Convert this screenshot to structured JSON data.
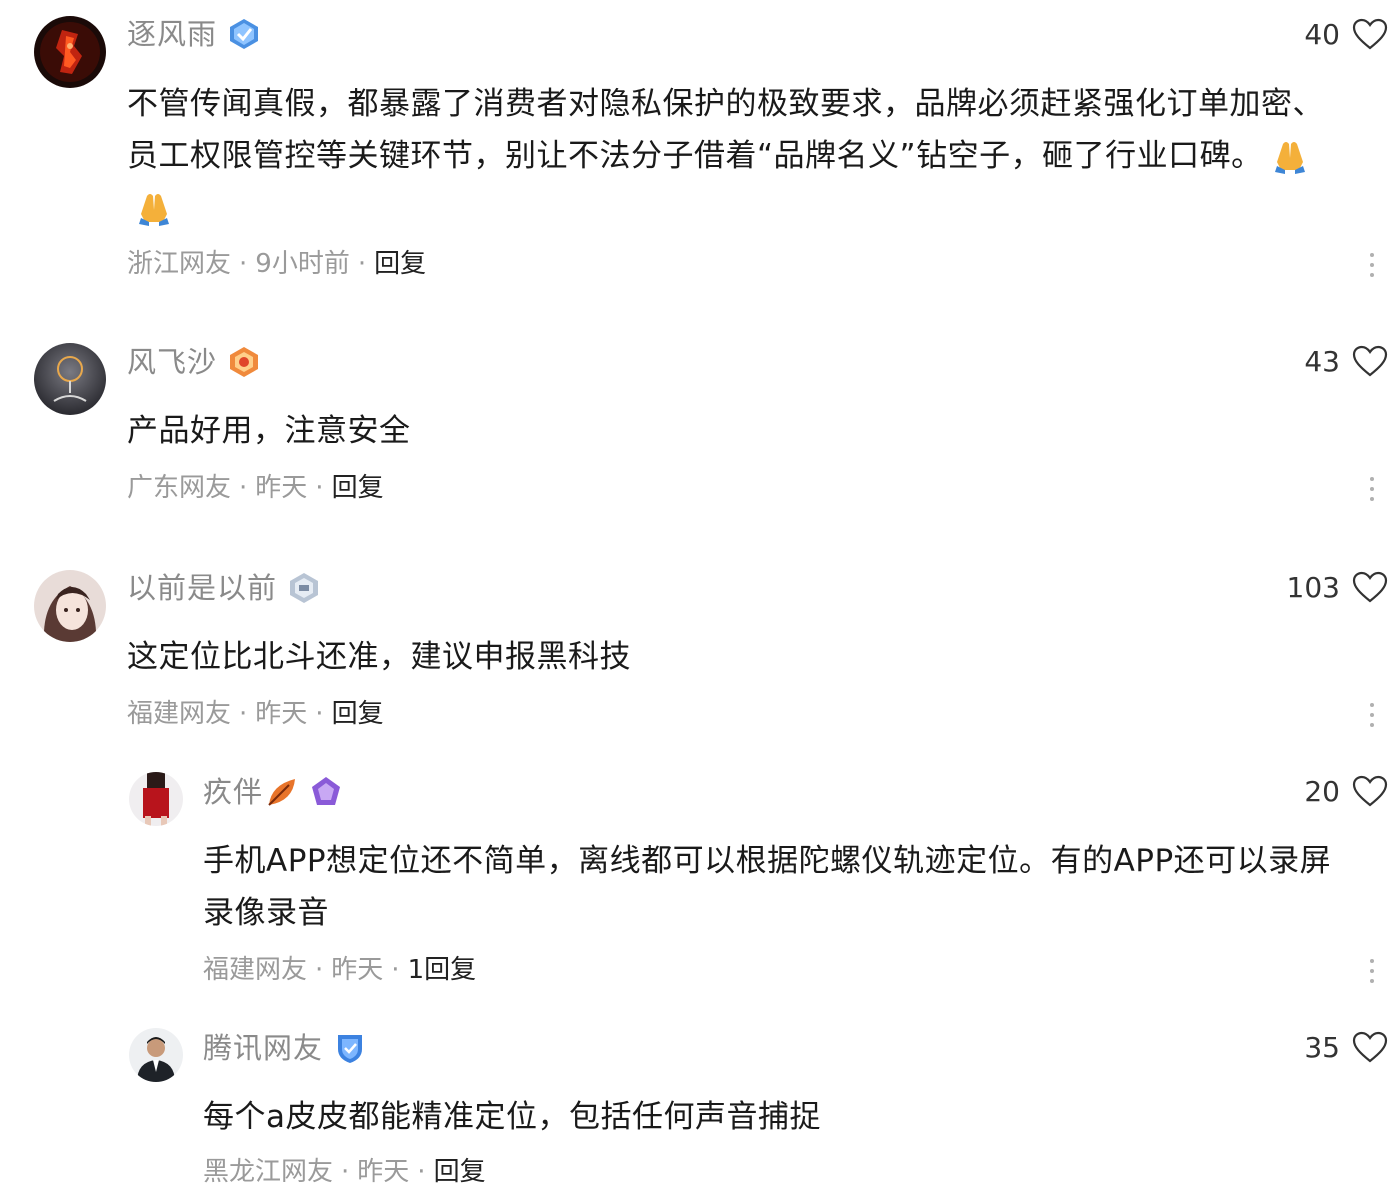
{
  "comments": [
    {
      "user": "逐风雨",
      "likes": "40",
      "text": "不管传闻真假，都暴露了消费者对隐私保护的极致要求，品牌必须赶紧强化订单加密、员工权限管控等关键环节，别让不法分子借着“品牌名义”钻空子，砸了行业口碑。",
      "location": "浙江网友",
      "time": "9小时前",
      "reply": "回复"
    },
    {
      "user": "风飞沙",
      "likes": "43",
      "text": "产品好用，注意安全",
      "location": "广东网友",
      "time": "昨天",
      "reply": "回复"
    },
    {
      "user": "以前是以前",
      "likes": "103",
      "text": "这定位比北斗还准，建议申报黑科技",
      "location": "福建网友",
      "time": "昨天",
      "reply": "回复"
    },
    {
      "user": "疚伴",
      "likes": "20",
      "text": "手机APP想定位还不简单，离线都可以根据陀螺仪轨迹定位。有的APP还可以录屏录像录音",
      "location": "福建网友",
      "time": "昨天",
      "reply": "1回复"
    },
    {
      "user": "腾讯网友",
      "likes": "35",
      "text": "每个a皮皮都能精准定位，包括任何声音捕捉",
      "location": "黑龙江网友",
      "time": "昨天",
      "reply": "回复"
    }
  ],
  "icons": {
    "like": "heart-outline-icon",
    "more": "vertical-ellipsis-icon",
    "emoji": "praying-hands-emoji"
  },
  "colors": {
    "name": "#8a8a8a",
    "meta": "#9a9a9a",
    "text": "#1a1a1a",
    "heart_stroke": "#333333"
  }
}
